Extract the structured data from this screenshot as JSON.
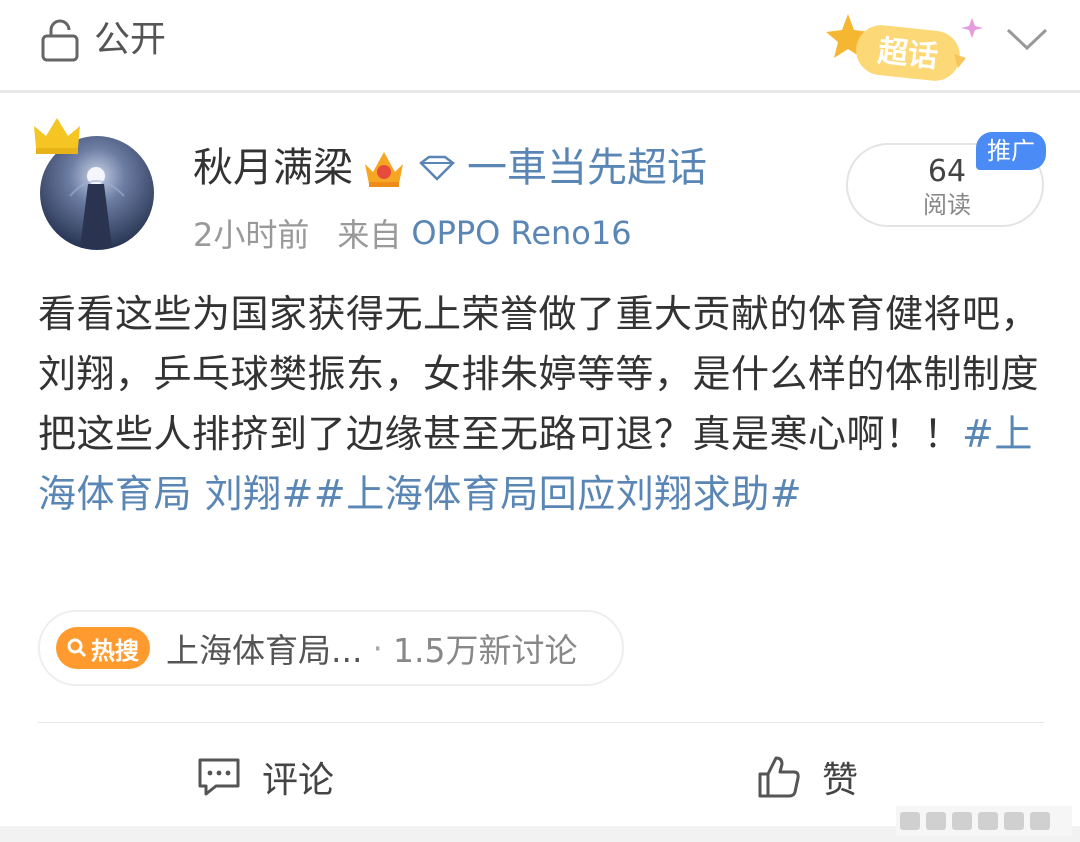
{
  "topbar": {
    "visibility_label": "公开",
    "supertopic_badge_label": "超话"
  },
  "post": {
    "username": "秋月满梁",
    "supertopic_name": "一車当先超话",
    "time": "2小时前",
    "from_prefix": "来自",
    "device": "OPPO Reno16",
    "read_count": "64",
    "read_label": "阅读",
    "promo_tag": "推广",
    "body_text": "看看这些为国家获得无上荣誉做了重大贡献的体育健将吧，刘翔，乒乓球樊振东，女排朱婷等等，是什么样的体制制度把这些人排挤到了边缘甚至无路可退？真是寒心啊！！",
    "hashtags": "#上海体育局 刘翔##上海体育局回应刘翔求助#"
  },
  "hot_search": {
    "badge": "热搜",
    "title": "上海体育局...",
    "separator": "·",
    "count": "1.5万新讨论"
  },
  "actions": {
    "comment_label": "评论",
    "like_label": "赞"
  },
  "colors": {
    "link": "#5a86b5",
    "hot_badge": "#ff9a2e",
    "promo": "#4a8bf5",
    "supertopic_gold": "#f5b731"
  },
  "icons": [
    "lock-icon",
    "supertopic-badge-icon",
    "chevron-down-icon",
    "crown-icon",
    "vip-icon",
    "diamond-icon",
    "search-icon",
    "comment-icon",
    "like-icon"
  ]
}
